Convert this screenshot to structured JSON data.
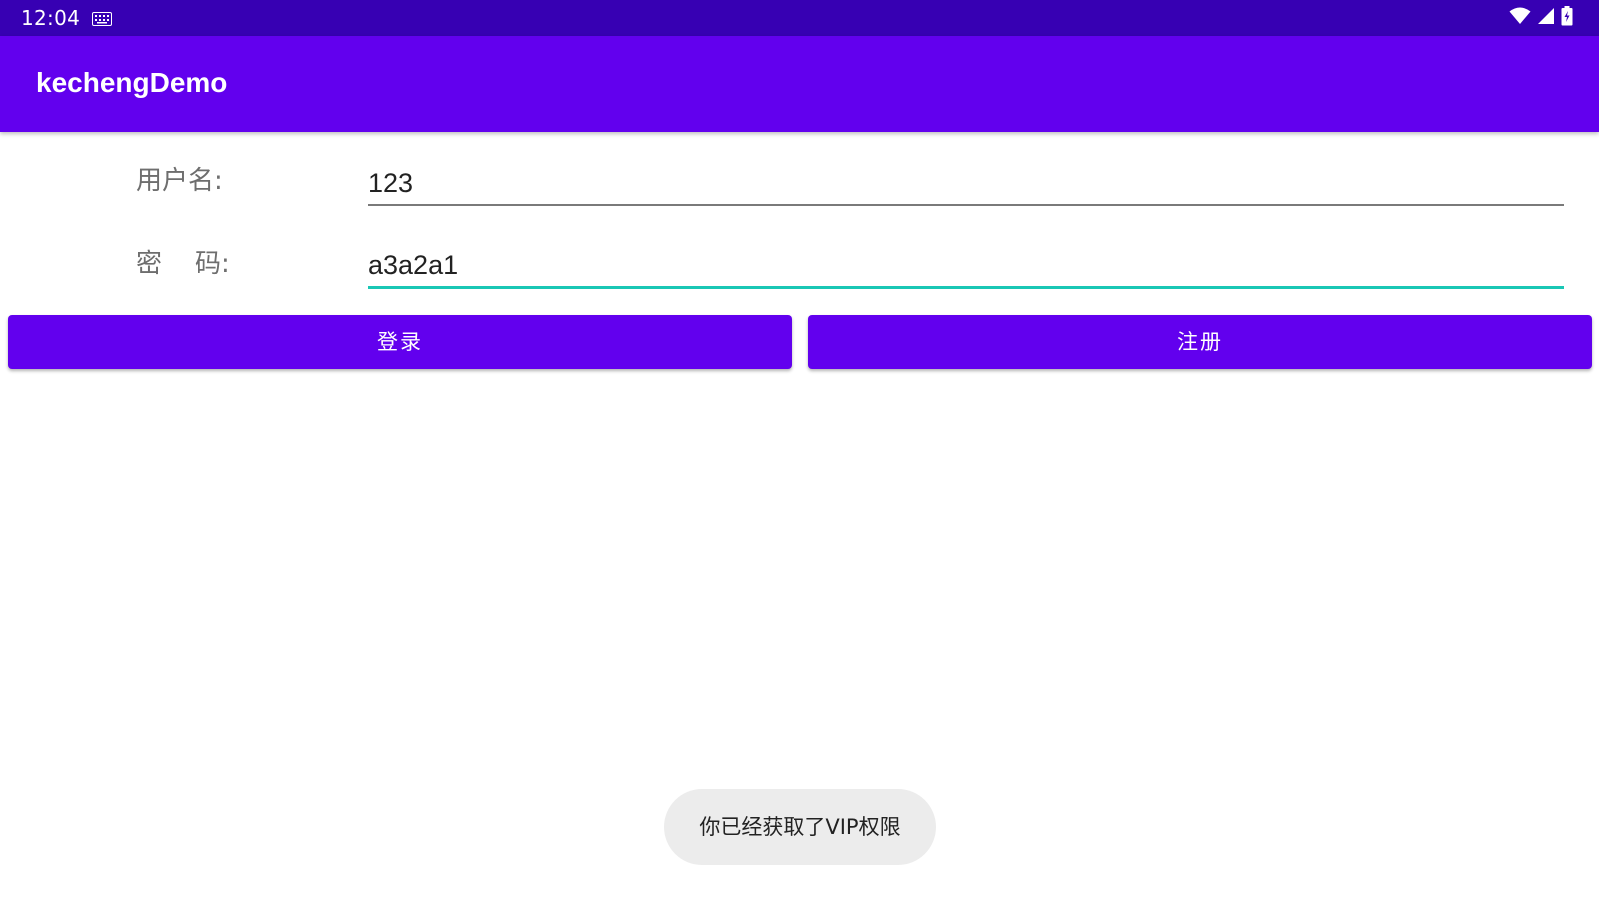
{
  "status_bar": {
    "time": "12:04",
    "icons": [
      "keyboard-icon",
      "wifi-icon",
      "cell-signal-icon",
      "battery-charging-icon"
    ]
  },
  "app_bar": {
    "title": "kechengDemo"
  },
  "form": {
    "username_label": "用户名:",
    "username_value": "123",
    "password_label": "密    码:",
    "password_value": "a3a2a1"
  },
  "buttons": {
    "login_label": "登录",
    "register_label": "注册"
  },
  "toast": {
    "message": "你已经获取了VIP权限"
  },
  "colors": {
    "status_bar": "#3700b3",
    "primary": "#6200ee",
    "focus_underline": "#19c7b5",
    "toast_bg": "#ececec"
  }
}
